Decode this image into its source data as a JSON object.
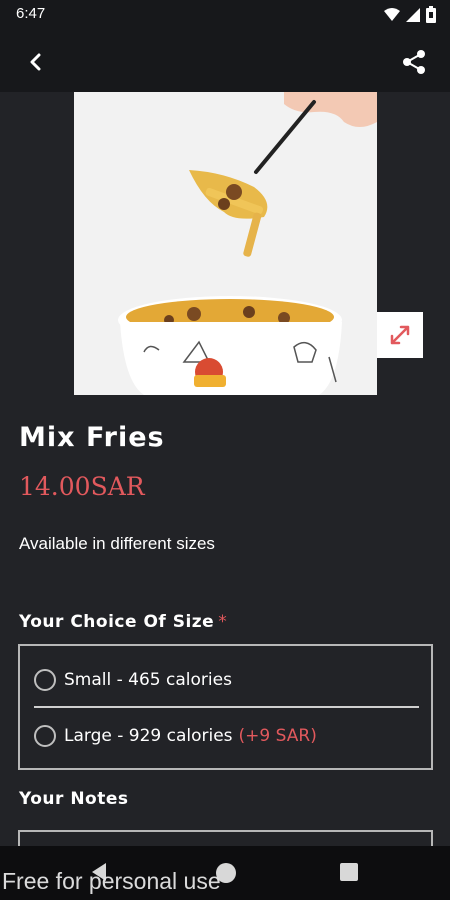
{
  "status_bar": {
    "time": "6:47",
    "icons": [
      "wifi-icon",
      "signal-icon",
      "battery-icon"
    ]
  },
  "app_bar": {
    "back_icon": "chevron-left-icon",
    "share_icon": "share-icon"
  },
  "product": {
    "image_alt_semantic": "food-photo",
    "expand_icon": "expand-icon",
    "name": "Mix Fries",
    "price": "14.00SAR",
    "description": "Available in different sizes"
  },
  "size_section": {
    "title": "Your Choice Of Size",
    "required_mark": "*",
    "options": [
      {
        "label": "Small - 465 calories",
        "extra": ""
      },
      {
        "label": "Large - 929 calories",
        "extra": "(+9 SAR)"
      }
    ]
  },
  "notes_section": {
    "title": "Your Notes"
  },
  "nav_bar": {
    "icons": [
      "nav-back-icon",
      "nav-home-icon",
      "nav-recents-icon"
    ]
  },
  "watermark": "Free for personal use",
  "colors": {
    "accent": "#e2595d",
    "background": "#222327",
    "bar": "#17181b"
  }
}
